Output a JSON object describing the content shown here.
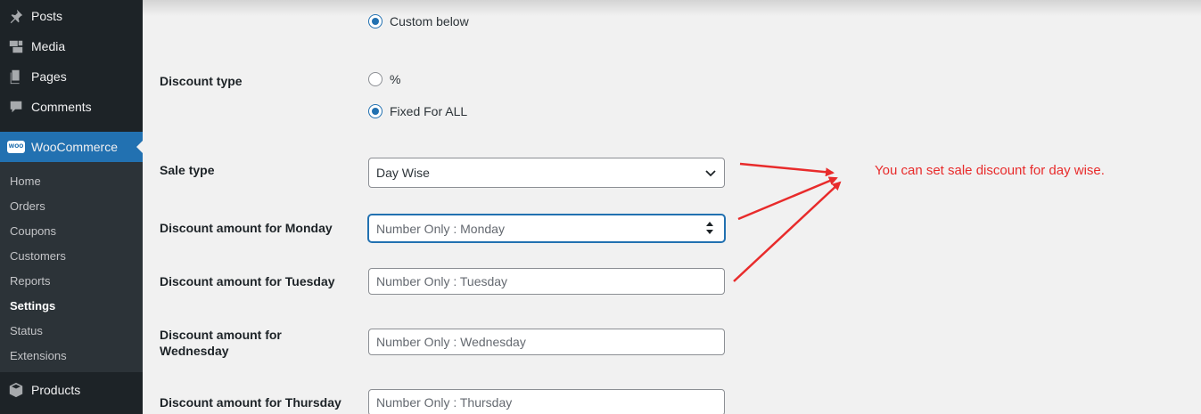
{
  "sidebar": {
    "menu": [
      {
        "label": "Posts",
        "icon": "pin-icon"
      },
      {
        "label": "Media",
        "icon": "media-icon"
      },
      {
        "label": "Pages",
        "icon": "pages-icon"
      },
      {
        "label": "Comments",
        "icon": "comments-icon"
      }
    ],
    "woocommerce": {
      "label": "WooCommerce",
      "icon_text": "WOO"
    },
    "submenu": [
      "Home",
      "Orders",
      "Coupons",
      "Customers",
      "Reports",
      "Settings",
      "Status",
      "Extensions"
    ],
    "current_submenu": "Settings",
    "products": {
      "label": "Products"
    }
  },
  "form": {
    "custom_below": "Custom below",
    "discount_type": {
      "label": "Discount type",
      "options": [
        "%",
        "Fixed For ALL"
      ],
      "selected": "Fixed For ALL"
    },
    "sale_type": {
      "label": "Sale type",
      "value": "Day Wise"
    },
    "days": [
      {
        "label": "Discount amount for Monday",
        "placeholder": "Number Only : Monday"
      },
      {
        "label": "Discount amount for Tuesday",
        "placeholder": "Number Only : Tuesday"
      },
      {
        "label_line1": "Discount amount for",
        "label_line2": "Wednesday",
        "placeholder": "Number Only : Wednesday"
      },
      {
        "label": "Discount amount for Thursday",
        "placeholder": "Number Only : Thursday"
      }
    ]
  },
  "annotation": {
    "text": "You can set sale discount for day wise.",
    "color": "#e82b2b"
  },
  "colors": {
    "sidebar_bg": "#1d2327",
    "submenu_bg": "#2c3338",
    "accent": "#2271b1",
    "page_bg": "#f1f1f1"
  }
}
